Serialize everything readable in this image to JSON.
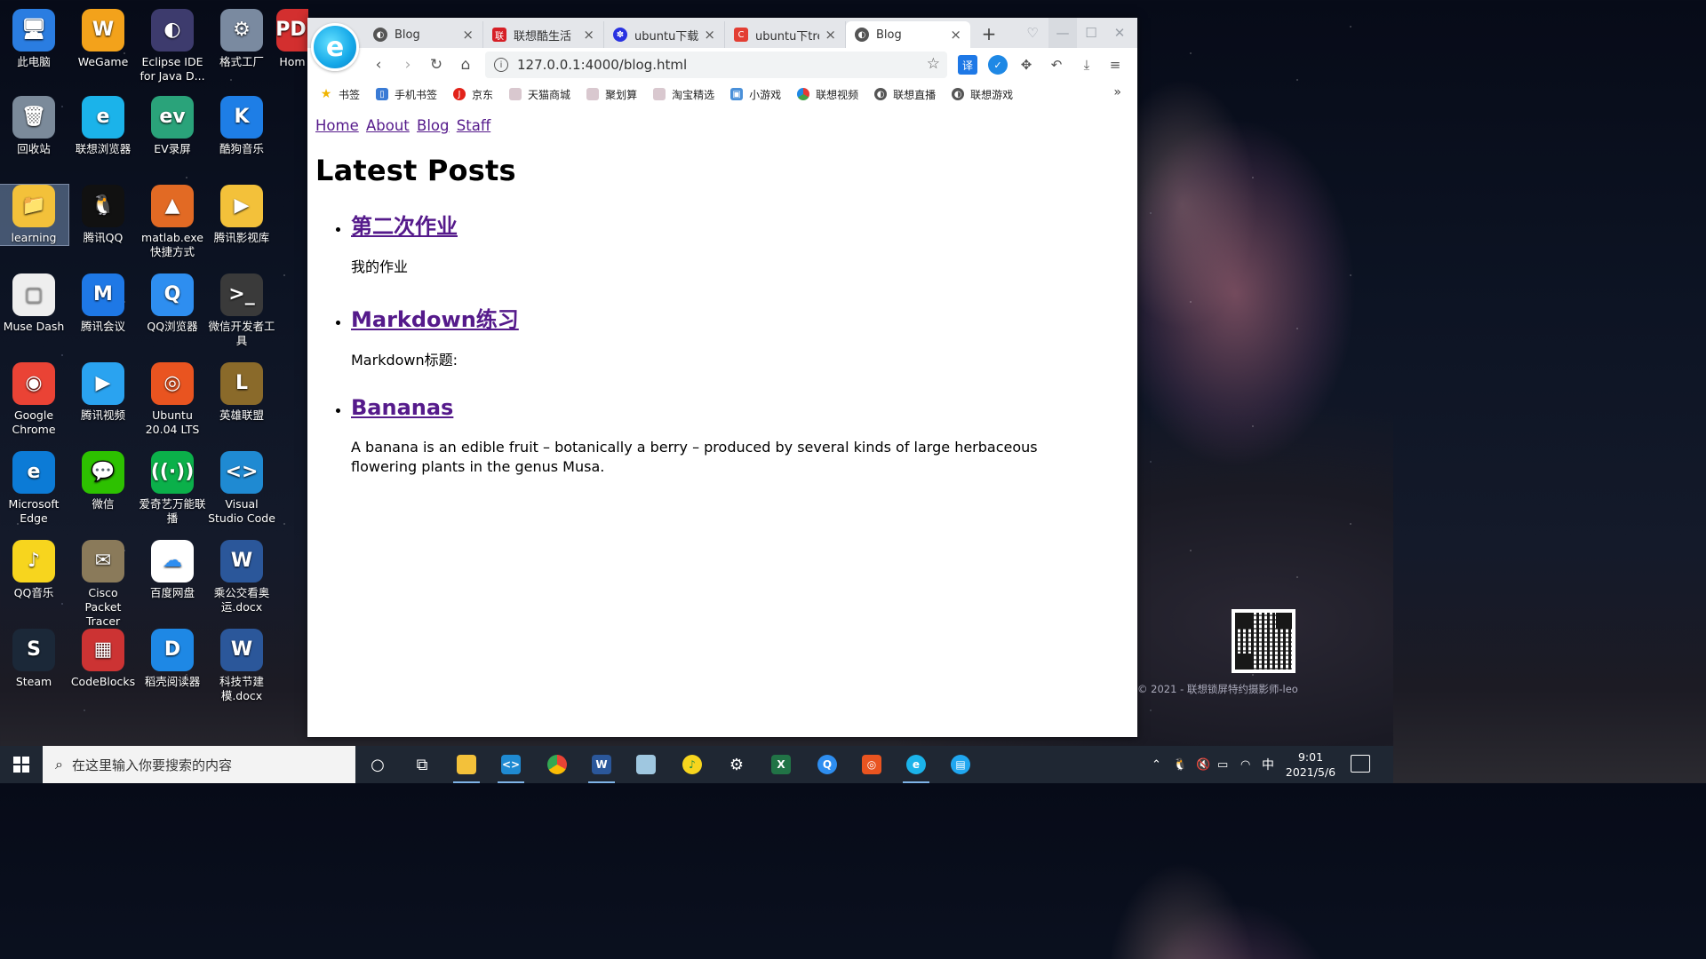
{
  "desktop": {
    "icons": [
      {
        "label": "此电脑",
        "glyph": "🖥"
      },
      {
        "label": "WeGame",
        "glyph": "W"
      },
      {
        "label": "Eclipse IDE for Java D...",
        "glyph": "◐"
      },
      {
        "label": "格式工厂",
        "glyph": "⚙"
      },
      {
        "label": "Hom",
        "glyph": "PDF"
      },
      {
        "label": "回收站",
        "glyph": "🗑"
      },
      {
        "label": "联想浏览器",
        "glyph": "e"
      },
      {
        "label": "EV录屏",
        "glyph": "ev"
      },
      {
        "label": "酷狗音乐",
        "glyph": "K"
      },
      {
        "label": "learning",
        "glyph": "📁"
      },
      {
        "label": "腾讯QQ",
        "glyph": "🐧"
      },
      {
        "label": "matlab.exe 快捷方式",
        "glyph": "▲"
      },
      {
        "label": "腾讯影视库",
        "glyph": "▶"
      },
      {
        "label": "Muse Dash",
        "glyph": "▢"
      },
      {
        "label": "腾讯会议",
        "glyph": "M"
      },
      {
        "label": "QQ浏览器",
        "glyph": "Q"
      },
      {
        "label": "微信开发者工具",
        "glyph": ">_"
      },
      {
        "label": "Google Chrome",
        "glyph": "◉"
      },
      {
        "label": "腾讯视频",
        "glyph": "▶"
      },
      {
        "label": "Ubuntu 20.04 LTS",
        "glyph": "◎"
      },
      {
        "label": "英雄联盟",
        "glyph": "L"
      },
      {
        "label": "Microsoft Edge",
        "glyph": "e"
      },
      {
        "label": "微信",
        "glyph": "💬"
      },
      {
        "label": "爱奇艺万能联播",
        "glyph": "((·))"
      },
      {
        "label": "Visual Studio Code",
        "glyph": "<>"
      },
      {
        "label": "QQ音乐",
        "glyph": "♪"
      },
      {
        "label": "Cisco Packet Tracer",
        "glyph": "✉"
      },
      {
        "label": "百度网盘",
        "glyph": "☁"
      },
      {
        "label": "乘公交看奥运.docx",
        "glyph": "W"
      },
      {
        "label": "Steam",
        "glyph": "S"
      },
      {
        "label": "CodeBlocks",
        "glyph": "▦"
      },
      {
        "label": "稻壳阅读器",
        "glyph": "D"
      },
      {
        "label": "科技节建模.docx",
        "glyph": "W"
      }
    ],
    "copyright": "© 2021 - 联想锁屏特约摄影师-leo"
  },
  "browser": {
    "tabs": [
      {
        "title": "Blog",
        "close": "×"
      },
      {
        "title": "联想酷生活",
        "close": "×"
      },
      {
        "title": "ubuntu下载t",
        "close": "×"
      },
      {
        "title": "ubuntu下tre",
        "close": "×"
      },
      {
        "title": "Blog",
        "close": "×"
      }
    ],
    "new_tab": "+",
    "address": "127.0.0.1:4000/blog.html",
    "bookmarks": [
      "书签",
      "手机书签",
      "京东",
      "天猫商城",
      "聚划算",
      "淘宝精选",
      "小游戏",
      "联想视频",
      "联想直播",
      "联想游戏"
    ],
    "bookmarks_more": "»"
  },
  "page": {
    "nav": [
      "Home",
      "About",
      "Blog",
      "Staff"
    ],
    "heading": "Latest Posts",
    "posts": [
      {
        "title": "第二次作业",
        "excerpt": "我的作业"
      },
      {
        "title": "Markdown练习",
        "excerpt": "Markdown标题:"
      },
      {
        "title": "Bananas",
        "excerpt": "A banana is an edible fruit – botanically a berry – produced by several kinds of large herbaceous flowering plants in the genus Musa."
      }
    ]
  },
  "taskbar": {
    "search_placeholder": "在这里输入你要搜索的内容",
    "ime": "中",
    "time": "9:01",
    "date": "2021/5/6"
  }
}
